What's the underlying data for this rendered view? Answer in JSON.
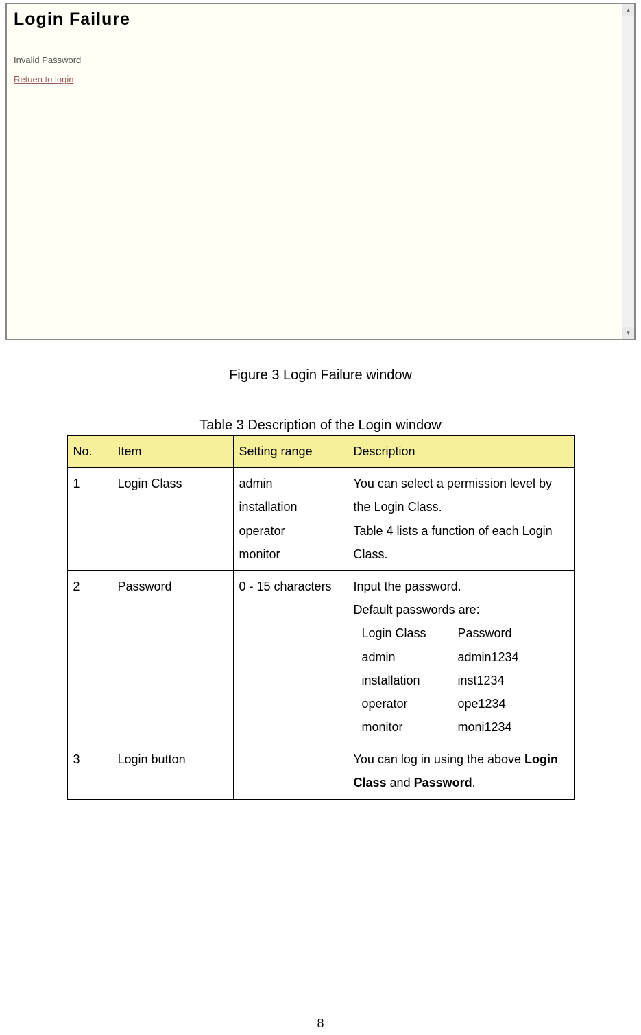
{
  "window": {
    "title": "Login Failure",
    "message": "Invalid Password",
    "link": "Retuen to login"
  },
  "figure_caption": "Figure 3 Login Failure window",
  "table_caption": "Table 3 Description of the Login window",
  "table": {
    "headers": {
      "no": "No.",
      "item": "Item",
      "range": "Setting range",
      "desc": "Description"
    },
    "rows": [
      {
        "no": "1",
        "item": "Login Class",
        "range": "admin\ninstallation\noperator\nmonitor",
        "desc": "You can select a permission level by the Login Class.\nTable 4 lists a function of each Login Class."
      },
      {
        "no": "2",
        "item": "Password",
        "range": "0 - 15 characters",
        "desc_intro": "Input the password.\nDefault passwords are:",
        "passwords_header": {
          "class": "Login Class",
          "pass": "Password"
        },
        "passwords": [
          {
            "class": "admin",
            "pass": "admin1234"
          },
          {
            "class": "installation",
            "pass": "inst1234"
          },
          {
            "class": "operator",
            "pass": "ope1234"
          },
          {
            "class": "monitor",
            "pass": "moni1234"
          }
        ]
      },
      {
        "no": "3",
        "item": "Login button",
        "range": "",
        "desc_parts": [
          "You can log in using the above ",
          "Login Class",
          " and ",
          "Password",
          "."
        ]
      }
    ]
  },
  "page_number": "8"
}
